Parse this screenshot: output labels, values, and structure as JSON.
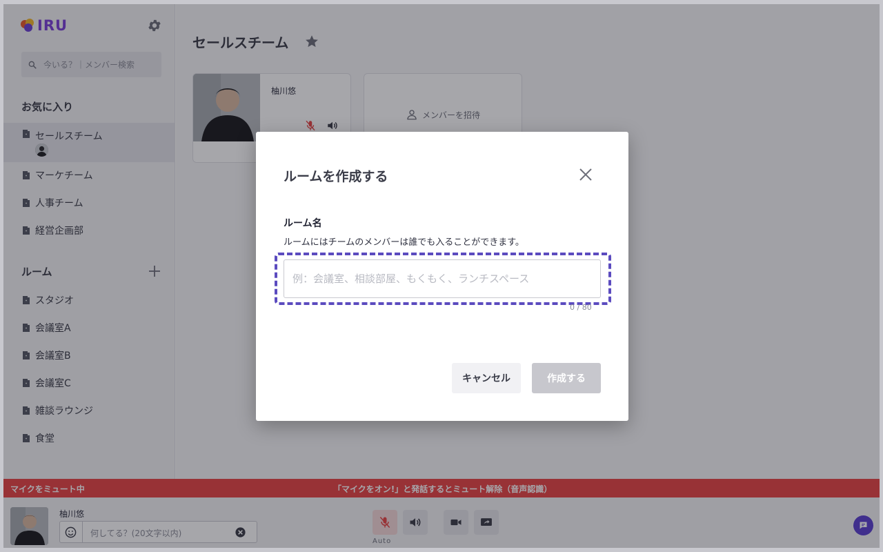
{
  "app": {
    "logo_text": "IRU"
  },
  "sidebar": {
    "search_placeholder": "今いる？｜メンバー検索",
    "favorites_heading": "お気に入り",
    "favorites": [
      {
        "label": "セールスチーム"
      },
      {
        "label": "マーケチーム"
      },
      {
        "label": "人事チーム"
      },
      {
        "label": "経営企画部"
      }
    ],
    "rooms_heading": "ルーム",
    "rooms": [
      {
        "label": "スタジオ"
      },
      {
        "label": "会議室A"
      },
      {
        "label": "会議室B"
      },
      {
        "label": "会議室C"
      },
      {
        "label": "雑談ラウンジ"
      },
      {
        "label": "食堂"
      }
    ]
  },
  "main": {
    "team_title": "セールスチーム",
    "member": {
      "name": "柚川悠"
    },
    "invite_label": "メンバーを招待"
  },
  "banner": {
    "muted_text": "マイクをミュート中",
    "hint_text": "「マイクをオン!」と発話するとミュート解除（音声認識）"
  },
  "bottombar": {
    "user_name": "柚川悠",
    "status_placeholder": "何してる？(20文字以内)",
    "auto_label": "Auto"
  },
  "modal": {
    "title": "ルームを作成する",
    "field_label": "ルーム名",
    "field_help": "ルームにはチームのメンバーは誰でも入ることができます。",
    "input_placeholder": "例：会議室、相談部屋、もくもく、ランチスペース",
    "input_value": "",
    "counter": "0 / 80",
    "cancel_label": "キャンセル",
    "create_label": "作成する"
  },
  "colors": {
    "brand": "#7b3fd8",
    "mute_banner": "#e84545",
    "focus_ring": "#5b4bbf",
    "chat_button": "#5b3fd0"
  }
}
